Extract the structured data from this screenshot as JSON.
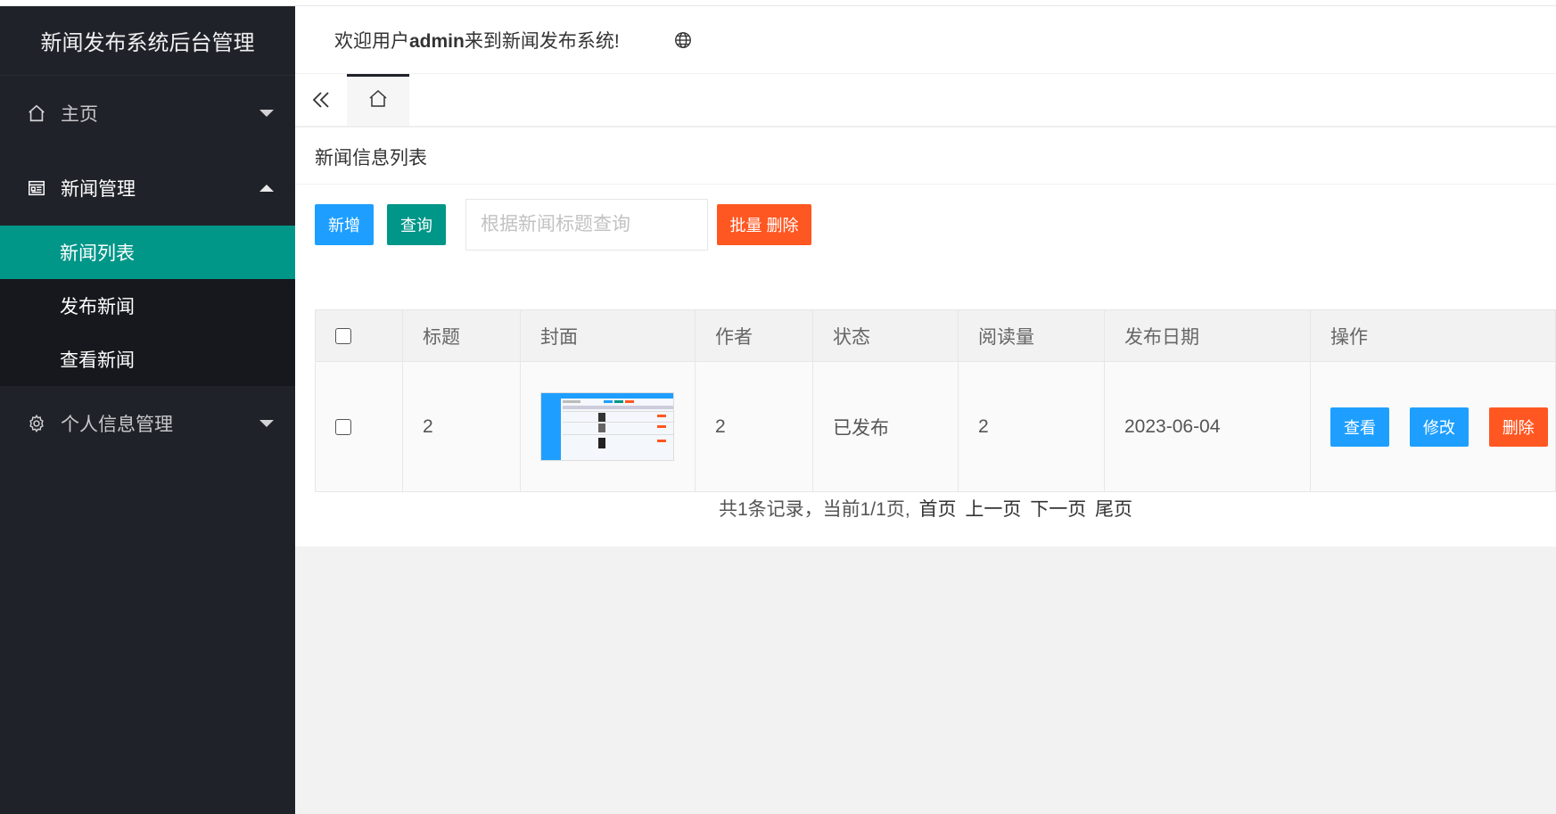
{
  "app": {
    "title": "新闻发布系统后台管理"
  },
  "header": {
    "welcome_prefix": "欢迎用户",
    "username": "admin",
    "welcome_suffix": "来到新闻发布系统!"
  },
  "sidebar": {
    "items": [
      {
        "label": "主页",
        "icon": "home-icon"
      },
      {
        "label": "新闻管理",
        "icon": "news-icon",
        "children": [
          {
            "label": "新闻列表"
          },
          {
            "label": "发布新闻"
          },
          {
            "label": "查看新闻"
          }
        ]
      },
      {
        "label": "个人信息管理",
        "icon": "gear-icon"
      }
    ]
  },
  "panel": {
    "title": "新闻信息列表"
  },
  "toolbar": {
    "add_label": "新增",
    "query_label": "查询",
    "search_placeholder": "根据新闻标题查询",
    "batch_delete_label": "批量 删除"
  },
  "table": {
    "headers": [
      "标题",
      "封面",
      "作者",
      "状态",
      "阅读量",
      "发布日期",
      "操作"
    ],
    "rows": [
      {
        "title": "2",
        "author": "2",
        "status": "已发布",
        "reads": "2",
        "date": "2023-06-04",
        "actions": {
          "view": "查看",
          "edit": "修改",
          "delete": "删除"
        }
      }
    ]
  },
  "pager": {
    "summary": "共1条记录，当前1/1页,",
    "first": "首页",
    "prev": "上一页",
    "next": "下一页",
    "last": "尾页"
  },
  "colors": {
    "sidebar_bg": "#20222a",
    "active": "#009688",
    "blue": "#1e9fff",
    "red": "#ff5722"
  }
}
